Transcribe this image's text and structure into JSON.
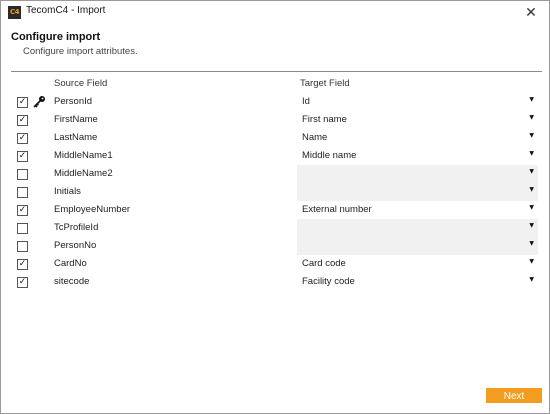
{
  "window": {
    "icon_text": "C4",
    "title": "TecomC4 - Import",
    "close_glyph": "✕"
  },
  "header": {
    "title": "Configure import",
    "subtitle": "Configure import attributes."
  },
  "columns": {
    "source": "Source Field",
    "target": "Target Field"
  },
  "rows": [
    {
      "checked": true,
      "key": true,
      "source": "PersonId",
      "target": "Id"
    },
    {
      "checked": true,
      "key": false,
      "source": "FirstName",
      "target": "First name"
    },
    {
      "checked": true,
      "key": false,
      "source": "LastName",
      "target": "Name"
    },
    {
      "checked": true,
      "key": false,
      "source": "MiddleName1",
      "target": "Middle name"
    },
    {
      "checked": false,
      "key": false,
      "source": "MiddleName2",
      "target": ""
    },
    {
      "checked": false,
      "key": false,
      "source": "Initials",
      "target": ""
    },
    {
      "checked": true,
      "key": false,
      "source": "EmployeeNumber",
      "target": "External number"
    },
    {
      "checked": false,
      "key": false,
      "source": "TcProfileId",
      "target": ""
    },
    {
      "checked": false,
      "key": false,
      "source": "PersonNo",
      "target": ""
    },
    {
      "checked": true,
      "key": false,
      "source": "CardNo",
      "target": "Card code"
    },
    {
      "checked": true,
      "key": false,
      "source": "sitecode",
      "target": "Facility code"
    }
  ],
  "glyphs": {
    "check": "✓",
    "chevron": "▼"
  },
  "footer": {
    "next_label": "Next"
  },
  "colors": {
    "accent": "#f29c20",
    "empty_select_bg": "#f1f1f1"
  },
  "icons": {
    "app": "tecom-c4-logo-icon",
    "key": "key-icon",
    "close": "close-icon",
    "dropdown": "chevron-down-icon"
  }
}
